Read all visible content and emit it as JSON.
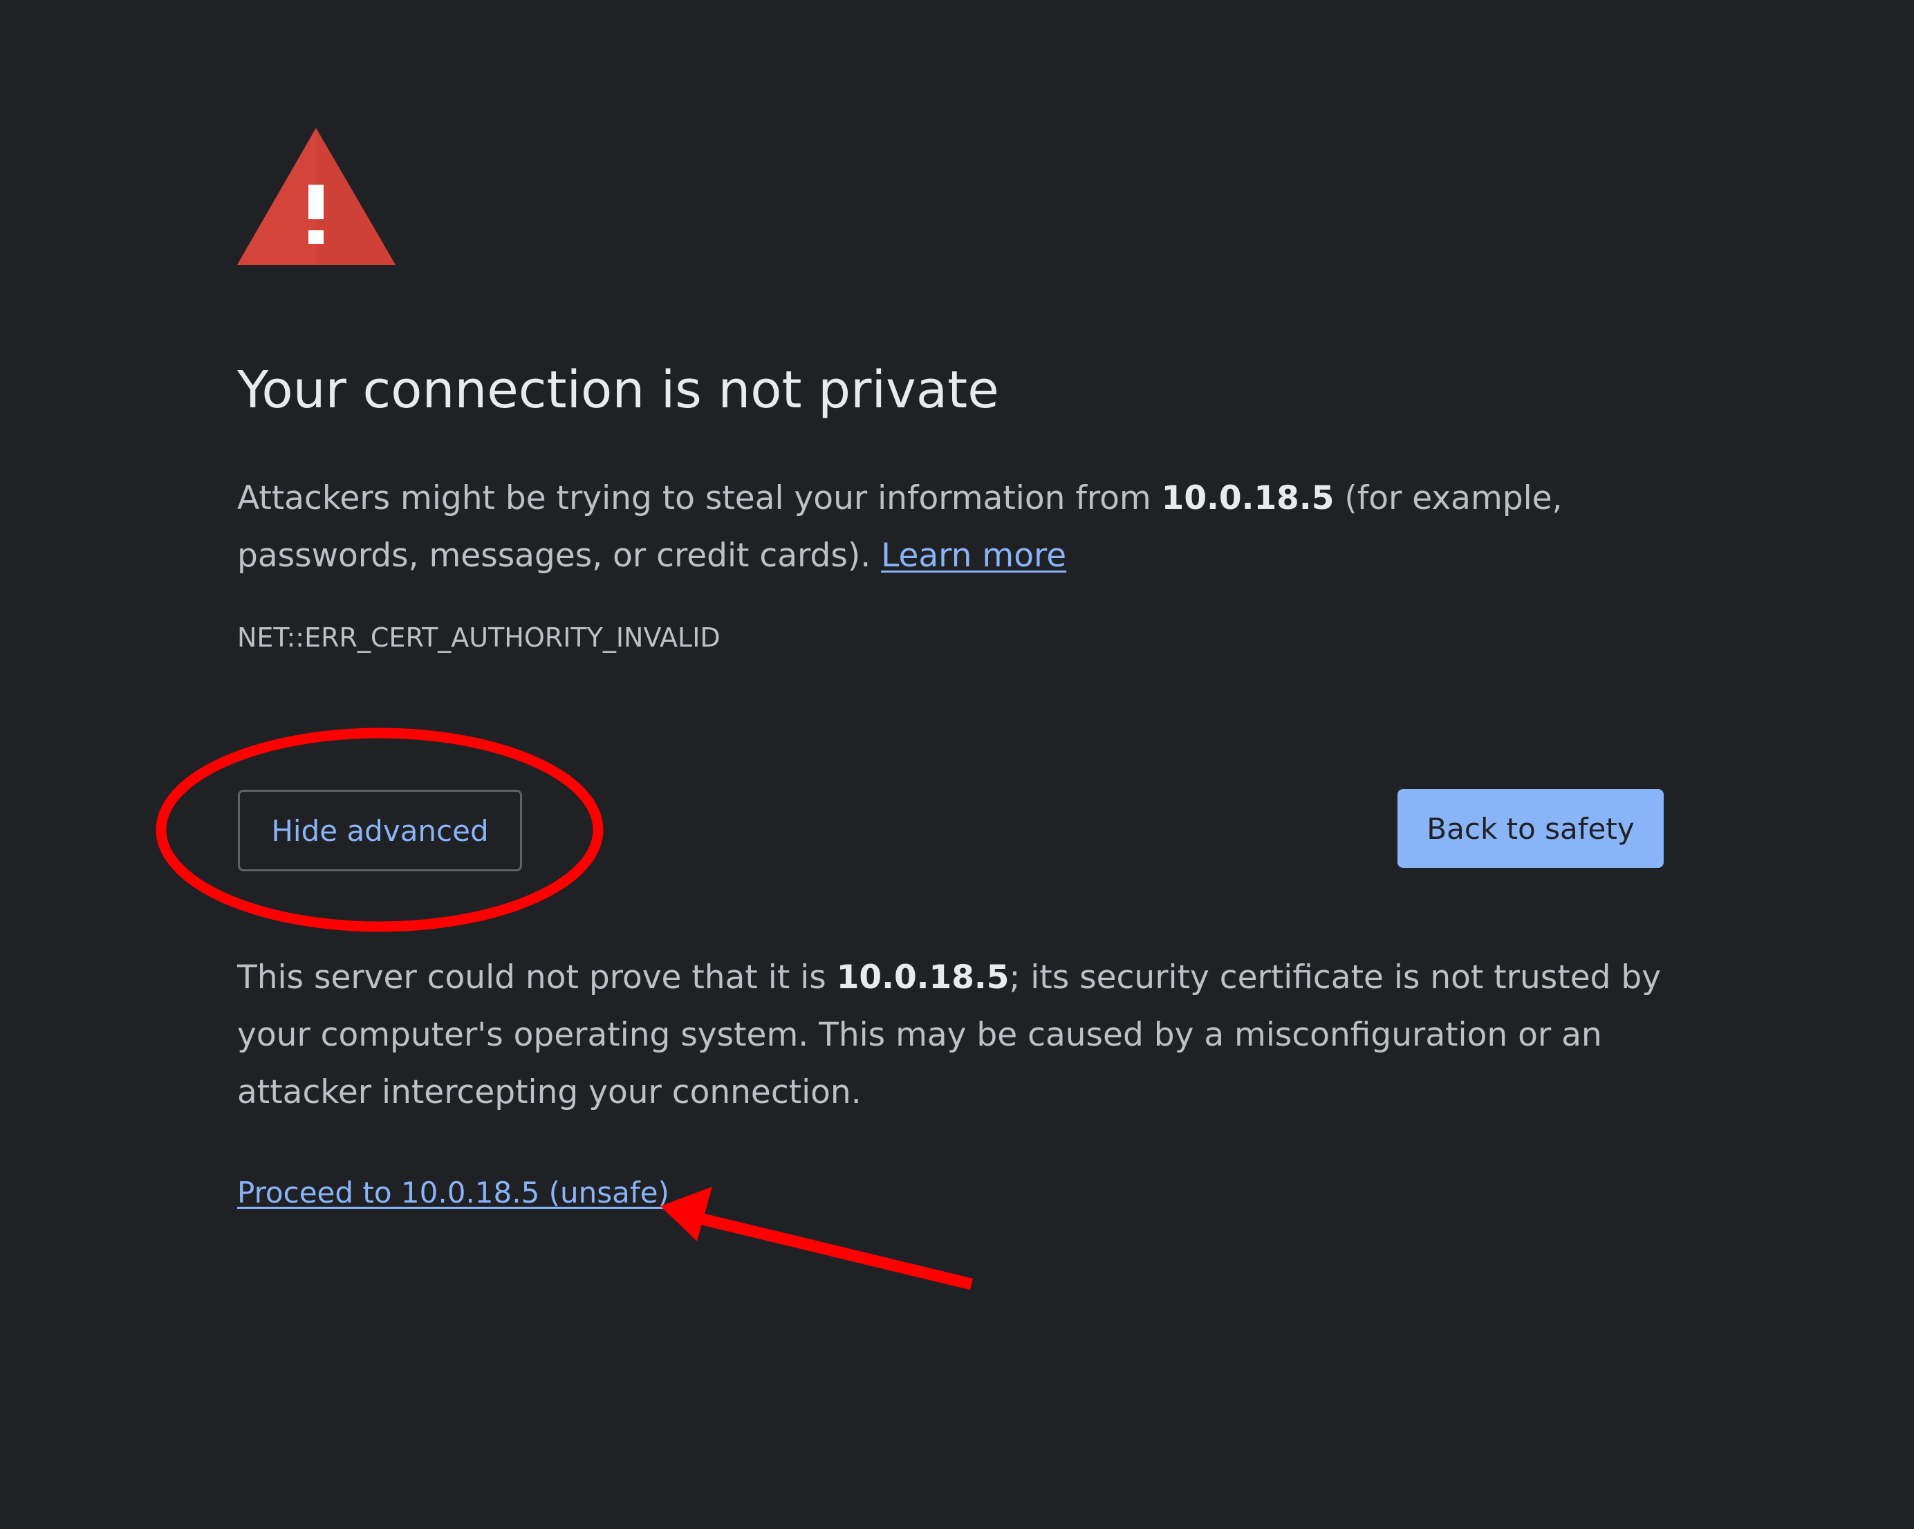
{
  "title": "Your connection is not private",
  "main_message": {
    "before_host": "Attackers might be trying to steal your information from ",
    "host": "10.0.18.5",
    "after_host": " (for example, passwords, messages, or credit cards). ",
    "learn_more": "Learn more"
  },
  "error_code": "NET::ERR_CERT_AUTHORITY_INVALID",
  "buttons": {
    "hide_advanced": "Hide advanced",
    "back_to_safety": "Back to safety"
  },
  "details": {
    "before_host": "This server could not prove that it is ",
    "host": "10.0.18.5",
    "after_host": "; its security certificate is not trusted by your computer's operating system. This may be caused by a misconfiguration or an attacker intercepting your connection."
  },
  "proceed_link": "Proceed to 10.0.18.5 (unsafe)",
  "icons": {
    "warning": "warning-triangle-icon"
  },
  "colors": {
    "background": "#202124",
    "warning_red": "#d93025",
    "link_blue": "#8ab4f8",
    "annotation_red": "#ff0000"
  }
}
